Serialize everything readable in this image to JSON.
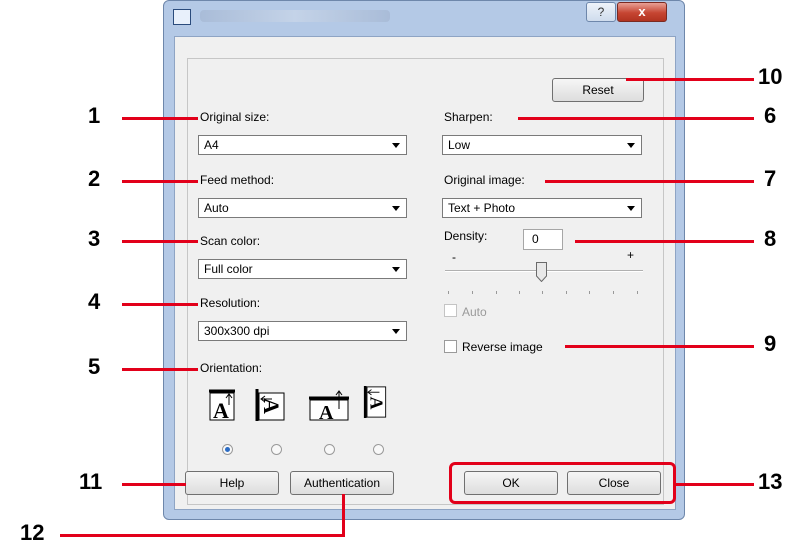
{
  "window": {
    "help_glyph": "?",
    "close_glyph": "x",
    "reset_label": "Reset"
  },
  "left": {
    "original_size_label": "Original size:",
    "original_size_value": "A4",
    "feed_method_label": "Feed method:",
    "feed_method_value": "Auto",
    "scan_color_label": "Scan color:",
    "scan_color_value": "Full color",
    "resolution_label": "Resolution:",
    "resolution_value": "300x300 dpi",
    "orientation_label": "Orientation:",
    "orientation_selected_index": 0
  },
  "right": {
    "sharpen_label": "Sharpen:",
    "sharpen_value": "Low",
    "original_image_label": "Original image:",
    "original_image_value": "Text + Photo",
    "density_label": "Density:",
    "density_value": "0",
    "density_minus": "-",
    "density_plus": "+",
    "auto_label": "Auto",
    "reverse_image_label": "Reverse image"
  },
  "buttons": {
    "help": "Help",
    "authentication": "Authentication",
    "ok": "OK",
    "close": "Close"
  },
  "callouts": {
    "n1": "1",
    "n2": "2",
    "n3": "3",
    "n4": "4",
    "n5": "5",
    "n6": "6",
    "n7": "7",
    "n8": "8",
    "n9": "9",
    "n10": "10",
    "n11": "11",
    "n12": "12",
    "n13": "13"
  },
  "colors": {
    "callout": "#e2001a",
    "radio_selected": "#2b6cc4"
  }
}
